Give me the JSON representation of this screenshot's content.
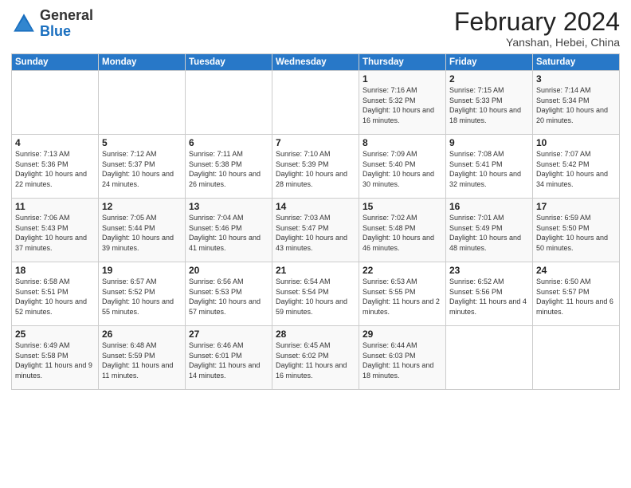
{
  "logo": {
    "general": "General",
    "blue": "Blue"
  },
  "header": {
    "month_year": "February 2024",
    "location": "Yanshan, Hebei, China"
  },
  "weekdays": [
    "Sunday",
    "Monday",
    "Tuesday",
    "Wednesday",
    "Thursday",
    "Friday",
    "Saturday"
  ],
  "weeks": [
    [
      {
        "day": "",
        "info": ""
      },
      {
        "day": "",
        "info": ""
      },
      {
        "day": "",
        "info": ""
      },
      {
        "day": "",
        "info": ""
      },
      {
        "day": "1",
        "info": "Sunrise: 7:16 AM\nSunset: 5:32 PM\nDaylight: 10 hours\nand 16 minutes."
      },
      {
        "day": "2",
        "info": "Sunrise: 7:15 AM\nSunset: 5:33 PM\nDaylight: 10 hours\nand 18 minutes."
      },
      {
        "day": "3",
        "info": "Sunrise: 7:14 AM\nSunset: 5:34 PM\nDaylight: 10 hours\nand 20 minutes."
      }
    ],
    [
      {
        "day": "4",
        "info": "Sunrise: 7:13 AM\nSunset: 5:36 PM\nDaylight: 10 hours\nand 22 minutes."
      },
      {
        "day": "5",
        "info": "Sunrise: 7:12 AM\nSunset: 5:37 PM\nDaylight: 10 hours\nand 24 minutes."
      },
      {
        "day": "6",
        "info": "Sunrise: 7:11 AM\nSunset: 5:38 PM\nDaylight: 10 hours\nand 26 minutes."
      },
      {
        "day": "7",
        "info": "Sunrise: 7:10 AM\nSunset: 5:39 PM\nDaylight: 10 hours\nand 28 minutes."
      },
      {
        "day": "8",
        "info": "Sunrise: 7:09 AM\nSunset: 5:40 PM\nDaylight: 10 hours\nand 30 minutes."
      },
      {
        "day": "9",
        "info": "Sunrise: 7:08 AM\nSunset: 5:41 PM\nDaylight: 10 hours\nand 32 minutes."
      },
      {
        "day": "10",
        "info": "Sunrise: 7:07 AM\nSunset: 5:42 PM\nDaylight: 10 hours\nand 34 minutes."
      }
    ],
    [
      {
        "day": "11",
        "info": "Sunrise: 7:06 AM\nSunset: 5:43 PM\nDaylight: 10 hours\nand 37 minutes."
      },
      {
        "day": "12",
        "info": "Sunrise: 7:05 AM\nSunset: 5:44 PM\nDaylight: 10 hours\nand 39 minutes."
      },
      {
        "day": "13",
        "info": "Sunrise: 7:04 AM\nSunset: 5:46 PM\nDaylight: 10 hours\nand 41 minutes."
      },
      {
        "day": "14",
        "info": "Sunrise: 7:03 AM\nSunset: 5:47 PM\nDaylight: 10 hours\nand 43 minutes."
      },
      {
        "day": "15",
        "info": "Sunrise: 7:02 AM\nSunset: 5:48 PM\nDaylight: 10 hours\nand 46 minutes."
      },
      {
        "day": "16",
        "info": "Sunrise: 7:01 AM\nSunset: 5:49 PM\nDaylight: 10 hours\nand 48 minutes."
      },
      {
        "day": "17",
        "info": "Sunrise: 6:59 AM\nSunset: 5:50 PM\nDaylight: 10 hours\nand 50 minutes."
      }
    ],
    [
      {
        "day": "18",
        "info": "Sunrise: 6:58 AM\nSunset: 5:51 PM\nDaylight: 10 hours\nand 52 minutes."
      },
      {
        "day": "19",
        "info": "Sunrise: 6:57 AM\nSunset: 5:52 PM\nDaylight: 10 hours\nand 55 minutes."
      },
      {
        "day": "20",
        "info": "Sunrise: 6:56 AM\nSunset: 5:53 PM\nDaylight: 10 hours\nand 57 minutes."
      },
      {
        "day": "21",
        "info": "Sunrise: 6:54 AM\nSunset: 5:54 PM\nDaylight: 10 hours\nand 59 minutes."
      },
      {
        "day": "22",
        "info": "Sunrise: 6:53 AM\nSunset: 5:55 PM\nDaylight: 11 hours\nand 2 minutes."
      },
      {
        "day": "23",
        "info": "Sunrise: 6:52 AM\nSunset: 5:56 PM\nDaylight: 11 hours\nand 4 minutes."
      },
      {
        "day": "24",
        "info": "Sunrise: 6:50 AM\nSunset: 5:57 PM\nDaylight: 11 hours\nand 6 minutes."
      }
    ],
    [
      {
        "day": "25",
        "info": "Sunrise: 6:49 AM\nSunset: 5:58 PM\nDaylight: 11 hours\nand 9 minutes."
      },
      {
        "day": "26",
        "info": "Sunrise: 6:48 AM\nSunset: 5:59 PM\nDaylight: 11 hours\nand 11 minutes."
      },
      {
        "day": "27",
        "info": "Sunrise: 6:46 AM\nSunset: 6:01 PM\nDaylight: 11 hours\nand 14 minutes."
      },
      {
        "day": "28",
        "info": "Sunrise: 6:45 AM\nSunset: 6:02 PM\nDaylight: 11 hours\nand 16 minutes."
      },
      {
        "day": "29",
        "info": "Sunrise: 6:44 AM\nSunset: 6:03 PM\nDaylight: 11 hours\nand 18 minutes."
      },
      {
        "day": "",
        "info": ""
      },
      {
        "day": "",
        "info": ""
      }
    ]
  ]
}
